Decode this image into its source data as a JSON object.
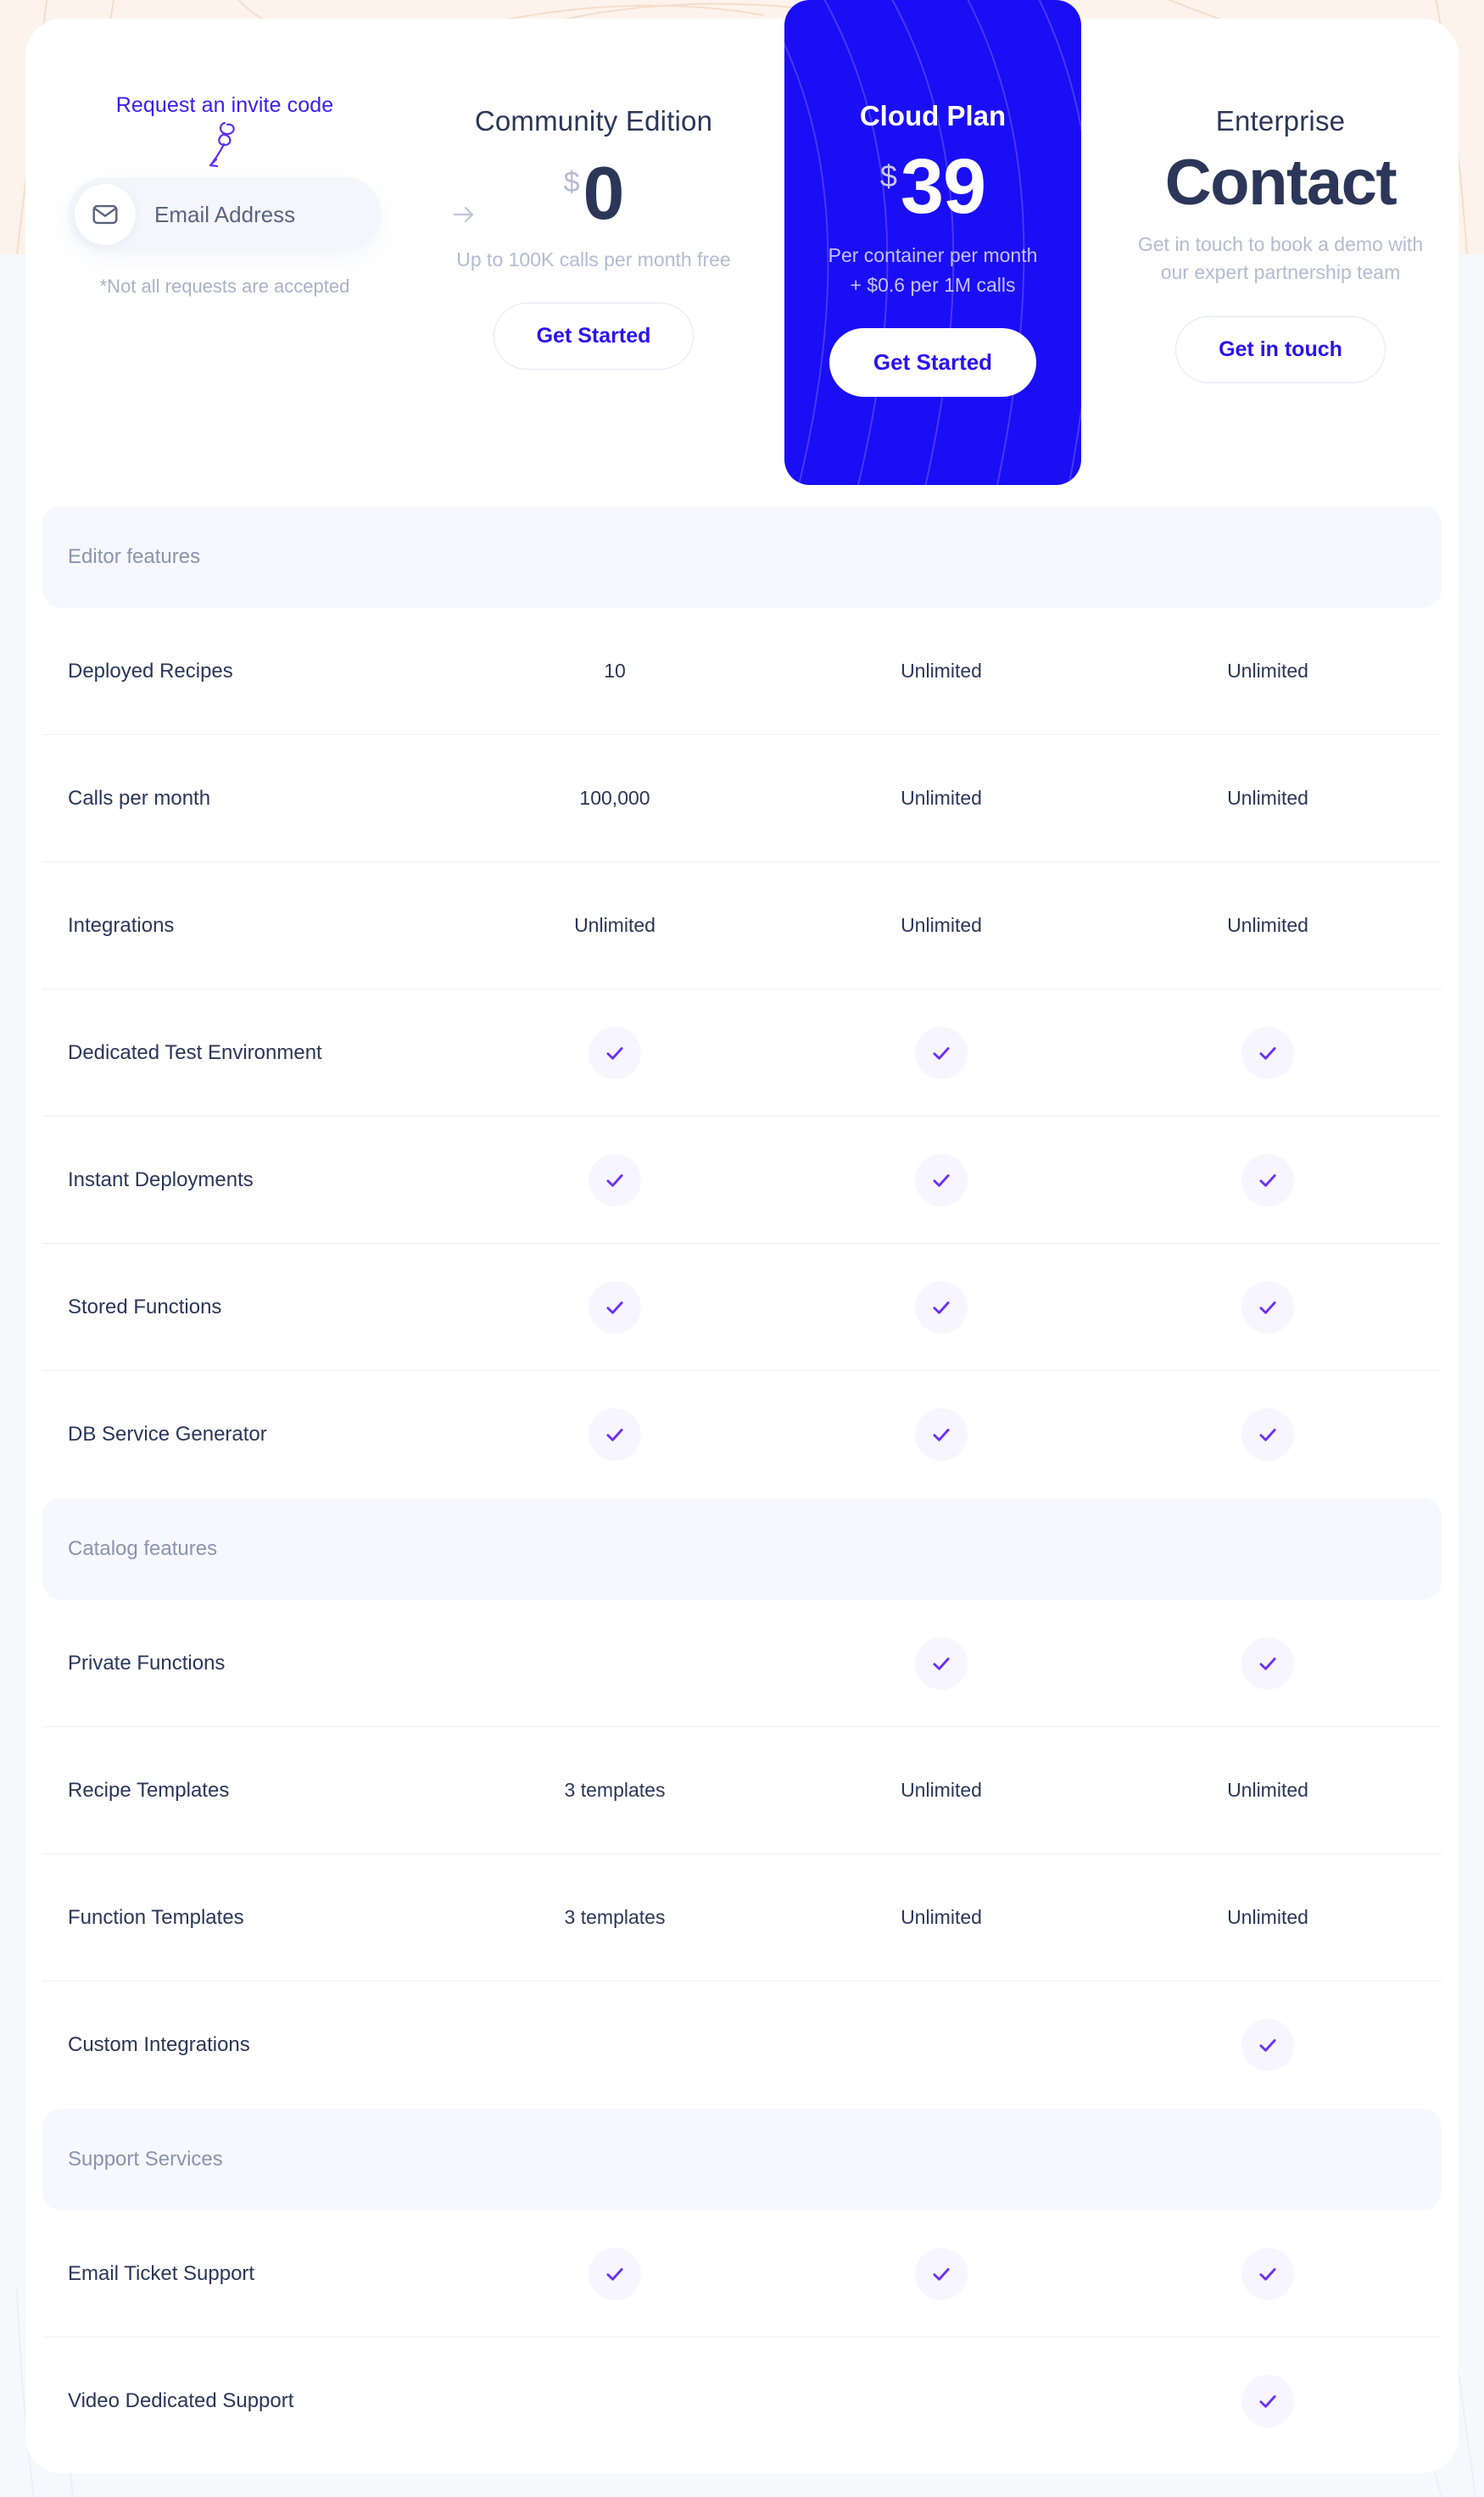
{
  "colors": {
    "accent_blue": "#1a0ef5",
    "link_blue": "#3b1df0",
    "check_purple": "#6d30f5",
    "heading_navy": "#2b3659",
    "muted": "#b4bbd1",
    "band_bg": "#f6f8fd",
    "page_bg_top": "#fdf3ec"
  },
  "invite": {
    "link_label": "Request an invite code",
    "email_placeholder": "Email Address",
    "email_value": "",
    "note": "*Not all requests are accepted",
    "envelope_icon": "envelope-icon",
    "arrow_icon": "arrow-right-icon",
    "squiggle_icon": "curly-arrow-icon"
  },
  "plans": [
    {
      "id": "community",
      "title": "Community Edition",
      "currency": "$",
      "amount": "0",
      "subtitle": "Up to 100K calls per month free",
      "cta": "Get Started",
      "highlighted": false
    },
    {
      "id": "cloud",
      "title": "Cloud Plan",
      "currency": "$",
      "amount": "39",
      "subtitle_line1": "Per container per month",
      "subtitle_line2": "+ $0.6 per 1M calls",
      "cta": "Get Started",
      "highlighted": true
    },
    {
      "id": "enterprise",
      "title": "Enterprise",
      "amount": "Contact",
      "subtitle_line1": "Get in touch to book a demo with",
      "subtitle_line2": "our expert partnership team",
      "cta": "Get in touch",
      "highlighted": false
    }
  ],
  "comparison": {
    "sections": [
      {
        "label": "Editor features",
        "rows": [
          {
            "feature": "Deployed Recipes",
            "community": "10",
            "cloud": "Unlimited",
            "enterprise": "Unlimited"
          },
          {
            "feature": "Calls per month",
            "community": "100,000",
            "cloud": "Unlimited",
            "enterprise": "Unlimited"
          },
          {
            "feature": "Integrations",
            "community": "Unlimited",
            "cloud": "Unlimited",
            "enterprise": "Unlimited"
          },
          {
            "feature": "Dedicated Test Environment",
            "community": "check",
            "cloud": "check",
            "enterprise": "check"
          },
          {
            "feature": "Instant Deployments",
            "community": "check",
            "cloud": "check",
            "enterprise": "check"
          },
          {
            "feature": "Stored Functions",
            "community": "check",
            "cloud": "check",
            "enterprise": "check"
          },
          {
            "feature": "DB Service Generator",
            "community": "check",
            "cloud": "check",
            "enterprise": "check"
          }
        ]
      },
      {
        "label": "Catalog features",
        "rows": [
          {
            "feature": "Private Functions",
            "community": "",
            "cloud": "check",
            "enterprise": "check"
          },
          {
            "feature": "Recipe Templates",
            "community": "3 templates",
            "cloud": "Unlimited",
            "enterprise": "Unlimited"
          },
          {
            "feature": "Function Templates",
            "community": "3 templates",
            "cloud": "Unlimited",
            "enterprise": "Unlimited"
          },
          {
            "feature": "Custom Integrations",
            "community": "",
            "cloud": "",
            "enterprise": "check"
          }
        ]
      },
      {
        "label": "Support Services",
        "rows": [
          {
            "feature": "Email Ticket Support",
            "community": "check",
            "cloud": "check",
            "enterprise": "check"
          },
          {
            "feature": "Video Dedicated Support",
            "community": "",
            "cloud": "",
            "enterprise": "check"
          }
        ]
      }
    ]
  }
}
